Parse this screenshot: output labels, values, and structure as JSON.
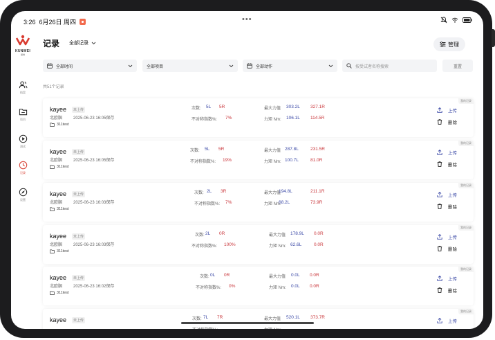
{
  "status": {
    "time": "3:26",
    "date": "6月26日 周四"
  },
  "brand": {
    "name": "KUNWEI",
    "sub": "鲲维"
  },
  "sidebar": {
    "items": [
      {
        "label": "档案",
        "icon": "users-icon"
      },
      {
        "label": "项目",
        "icon": "folder-icon"
      },
      {
        "label": "测试",
        "icon": "play-icon"
      },
      {
        "label": "记录",
        "icon": "clock-icon"
      },
      {
        "label": "设置",
        "icon": "compass-icon"
      }
    ]
  },
  "header": {
    "title": "记录",
    "filter": "全部记录",
    "manage": "管理"
  },
  "filters": {
    "time": "全部时间",
    "project": "全部项目",
    "action": "全部动作",
    "search_placeholder": "按受试者名称搜索",
    "reset": "重置"
  },
  "total": "共51个记录",
  "labels": {
    "count": "次数:",
    "asym": "不对称指数%:",
    "maxforce": "最大力值",
    "torque": "力矩 Nm:",
    "unuploaded": "未上传",
    "corner": "我的记录",
    "upload": "上传",
    "delete": "删除"
  },
  "records": [
    {
      "name": "kayee",
      "project": "北欧腘",
      "saved": "2025-06-23 16:05保存",
      "dir": "311test",
      "count_l": "5L",
      "count_r": "5R",
      "asym": "7%",
      "max_l": "303.2L",
      "max_r": "327.1R",
      "torque_l": "106.1L",
      "torque_r": "114.5R"
    },
    {
      "name": "kayee",
      "project": "北欧腘",
      "saved": "2025-06-23 16:05保存",
      "dir": "311test",
      "count_l": "5L",
      "count_r": "5R",
      "asym": "19%",
      "max_l": "287.8L",
      "max_r": "231.5R",
      "torque_l": "100.7L",
      "torque_r": "81.0R"
    },
    {
      "name": "kayee",
      "project": "北欧腘",
      "saved": "2025-06-23 16:03保存",
      "dir": "311test",
      "count_l": "2L",
      "count_r": "3R",
      "asym": "7%",
      "max_l": "194.8L",
      "max_r": "211.1R",
      "torque_l": "68.2L",
      "torque_r": "73.9R"
    },
    {
      "name": "kayee",
      "project": "北欧腘",
      "saved": "2025-06-23 16:03保存",
      "dir": "311test",
      "count_l": "2L",
      "count_r": "0R",
      "asym": "100%",
      "max_l": "178.9L",
      "max_r": "0.0R",
      "torque_l": "62.6L",
      "torque_r": "0.0R"
    },
    {
      "name": "kayee",
      "project": "北欧腘",
      "saved": "2025-06-23 16:02保存",
      "dir": "311test",
      "count_l": "0L",
      "count_r": "0R",
      "asym": "0%",
      "max_l": "0.0L",
      "max_r": "0.0R",
      "torque_l": "0.0L",
      "torque_r": "0.0R"
    },
    {
      "name": "kayee",
      "project": "",
      "saved": "",
      "dir": "",
      "count_l": "7L",
      "count_r": "7R",
      "asym": "",
      "max_l": "520.1L",
      "max_r": "373.7R",
      "torque_l": "",
      "torque_r": ""
    }
  ]
}
